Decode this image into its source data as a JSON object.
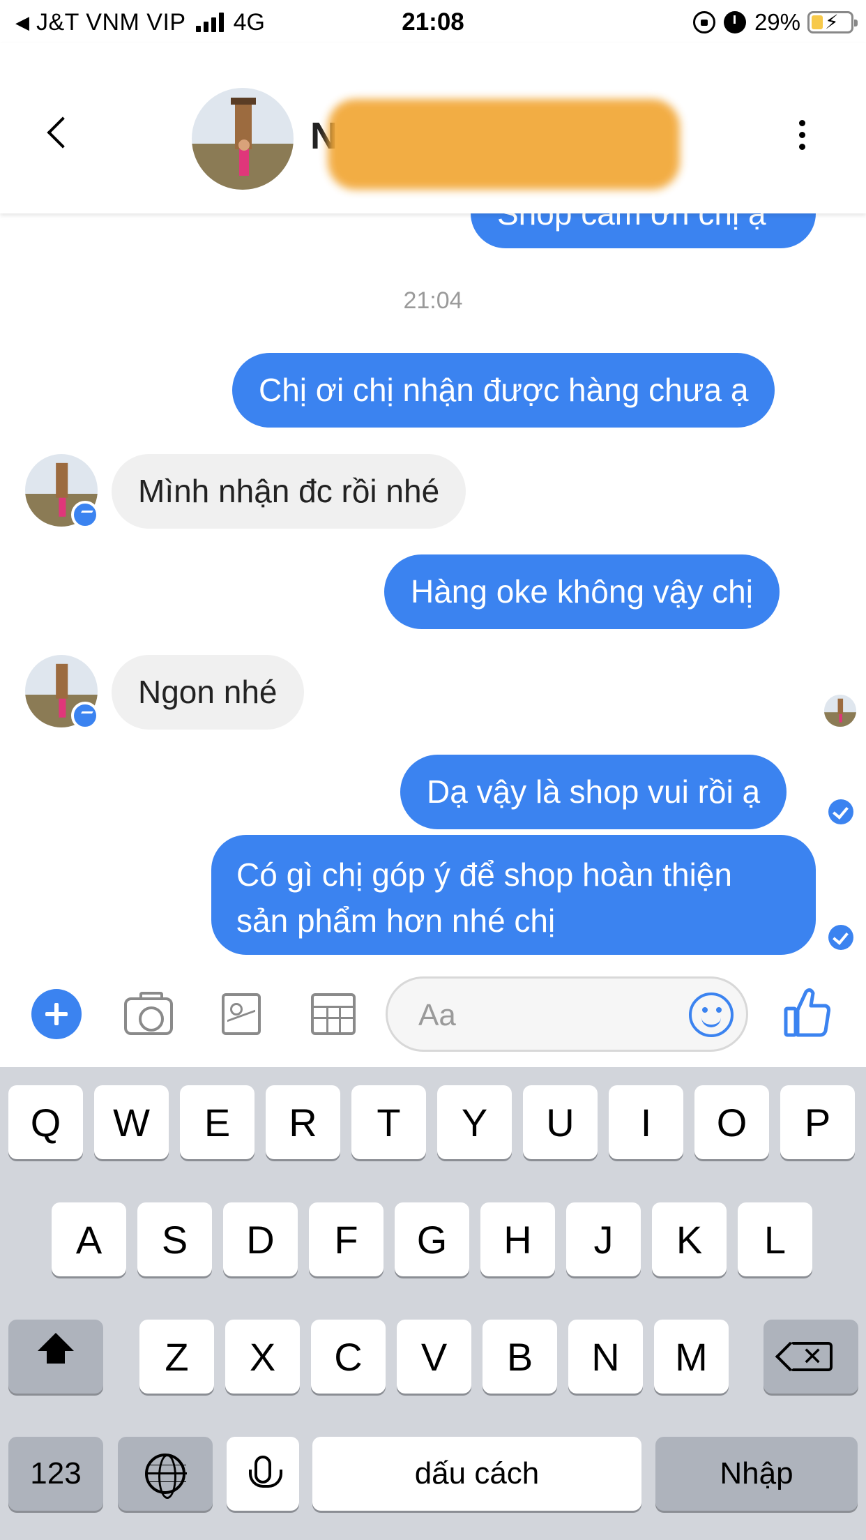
{
  "status_bar": {
    "back_glyph": "◀",
    "carrier": "J&T VNM VIP",
    "network": "4G",
    "time": "21:08",
    "battery_percent": "29%",
    "battery_level": 0.29
  },
  "header": {
    "contact_initial": "N",
    "back_icon": "chevron-left-icon",
    "more_icon": "more-vertical-icon"
  },
  "chat": {
    "partial_top_message": "Shop cảm ơn chị ạ",
    "timestamp": "21:04",
    "messages": [
      {
        "from": "me",
        "text": "Chị ơi chị nhận được hàng chưa ạ"
      },
      {
        "from": "contact",
        "text": "Mình nhận đc rồi nhé"
      },
      {
        "from": "me",
        "text": "Hàng oke không vậy chị"
      },
      {
        "from": "contact",
        "text": "Ngon nhé"
      },
      {
        "from": "me",
        "text": "Dạ vậy là shop vui rồi ạ"
      },
      {
        "from": "me",
        "text": "Có gì chị góp ý để shop hoàn thiện sản phẩm hơn nhé chị"
      }
    ]
  },
  "composer": {
    "placeholder": "Aa",
    "icons": [
      "plus-icon",
      "camera-icon",
      "image-icon",
      "grid-icon",
      "emoji-icon",
      "thumbs-up-icon"
    ]
  },
  "keyboard": {
    "row1": [
      "Q",
      "W",
      "E",
      "R",
      "T",
      "Y",
      "U",
      "I",
      "O",
      "P"
    ],
    "row2": [
      "A",
      "S",
      "D",
      "F",
      "G",
      "H",
      "J",
      "K",
      "L"
    ],
    "row3": [
      "Z",
      "X",
      "C",
      "V",
      "B",
      "N",
      "M"
    ],
    "numbers_key": "123",
    "space_key": "dấu cách",
    "return_key": "Nhập"
  },
  "colors": {
    "accent": "#3b83f0",
    "incoming_bubble": "#f0f0f0",
    "keyboard_bg": "#d2d5db",
    "redaction": "#f2a93b"
  }
}
